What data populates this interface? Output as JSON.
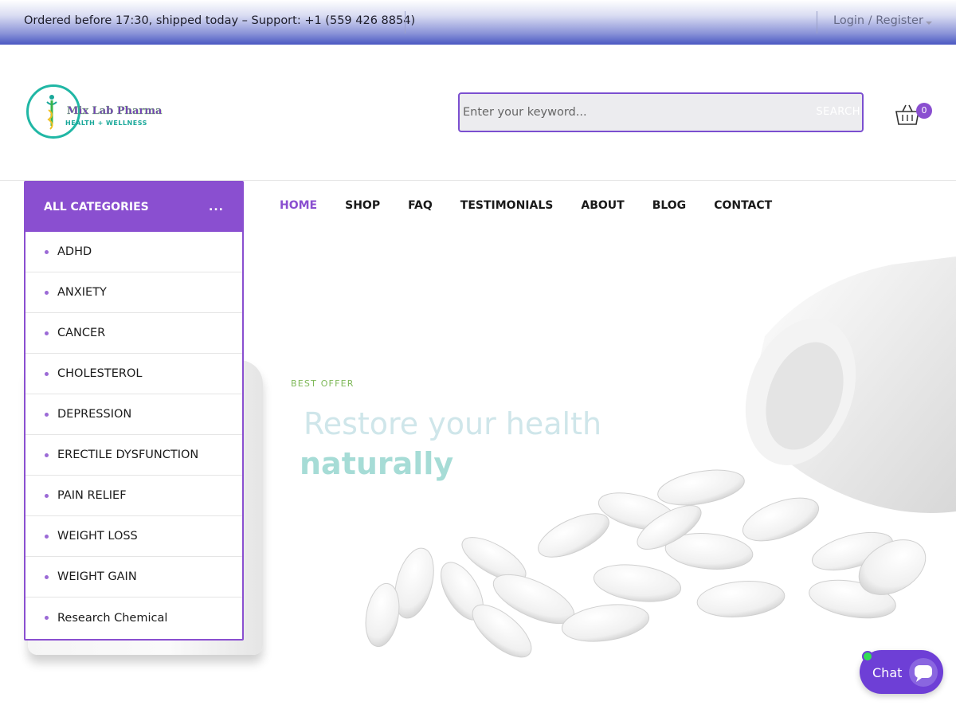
{
  "topbar": {
    "notice": "Ordered before 17:30, shipped today – Support: +1 (559 426 8854)",
    "login": "Login / Register"
  },
  "logo": {
    "name": "Mix Lab Pharma",
    "tagline": "HEALTH + WELLNESS"
  },
  "search": {
    "placeholder": "Enter your keyword...",
    "button": "SEARCH"
  },
  "cart": {
    "count": "0"
  },
  "categories": {
    "title": "ALL CATEGORIES",
    "more": "...",
    "items": [
      "ADHD",
      "ANXIETY",
      "CANCER",
      "CHOLESTEROL",
      "DEPRESSION",
      "ERECTILE DYSFUNCTION",
      "PAIN RELIEF",
      "WEIGHT LOSS",
      "WEIGHT GAIN",
      "Research Chemical"
    ]
  },
  "nav": [
    "HOME",
    "SHOP",
    "FAQ",
    "TESTIMONIALS",
    "ABOUT",
    "BLOG",
    "CONTACT"
  ],
  "hero": {
    "kicker": "BEST OFFER",
    "line1": "Restore your health",
    "line2": "naturally"
  },
  "chat": {
    "label": "Chat"
  },
  "colors": {
    "accent": "#8a4fd0",
    "hero_text": "#a6dcd6",
    "offer": "#7fb95a",
    "chat": "#6e3fd6"
  },
  "icons": {
    "cart": "basket-icon",
    "chat": "chat-bubble-icon"
  }
}
